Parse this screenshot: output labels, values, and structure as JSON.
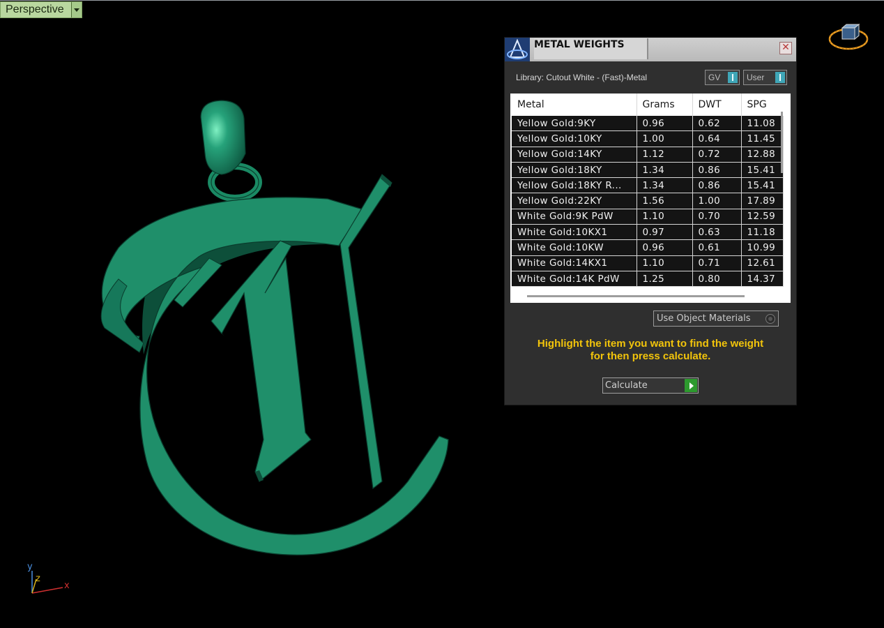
{
  "viewport": {
    "label": "Perspective"
  },
  "axes": {
    "y": "y",
    "z": "z",
    "x": "x"
  },
  "panel": {
    "title": "METAL WEIGHTS",
    "close_label": "✕",
    "library_text": "Library: Cutout White - (Fast)-Metal",
    "gv_label": "GV",
    "user_label": "User",
    "columns": [
      "Metal",
      "Grams",
      "DWT",
      "SPG"
    ],
    "rows": [
      [
        "Yellow Gold:9KY",
        "0.96",
        "0.62",
        "11.08"
      ],
      [
        "Yellow Gold:10KY",
        "1.00",
        "0.64",
        "11.45"
      ],
      [
        "Yellow Gold:14KY",
        "1.12",
        "0.72",
        "12.88"
      ],
      [
        "Yellow Gold:18KY",
        "1.34",
        "0.86",
        "15.41"
      ],
      [
        "Yellow Gold:18KY R...",
        "1.34",
        "0.86",
        "15.41"
      ],
      [
        "Yellow Gold:22KY",
        "1.56",
        "1.00",
        "17.89"
      ],
      [
        "White Gold:9K PdW",
        "1.10",
        "0.70",
        "12.59"
      ],
      [
        "White Gold:10KX1",
        "0.97",
        "0.63",
        "11.18"
      ],
      [
        "White Gold:10KW",
        "0.96",
        "0.61",
        "10.99"
      ],
      [
        "White Gold:14KX1",
        "1.10",
        "0.71",
        "12.61"
      ],
      [
        "White Gold:14K PdW",
        "1.25",
        "0.80",
        "14.37"
      ]
    ],
    "use_object_materials": "Use Object Materials",
    "instruction_line1": "Highlight the item you want to find the weight",
    "instruction_line2": "for then press calculate.",
    "calculate_label": "Calculate"
  },
  "colors": {
    "model": "#1f8f6a",
    "instruction": "#f2c40b",
    "viewport_tab": "#b9d79f"
  }
}
